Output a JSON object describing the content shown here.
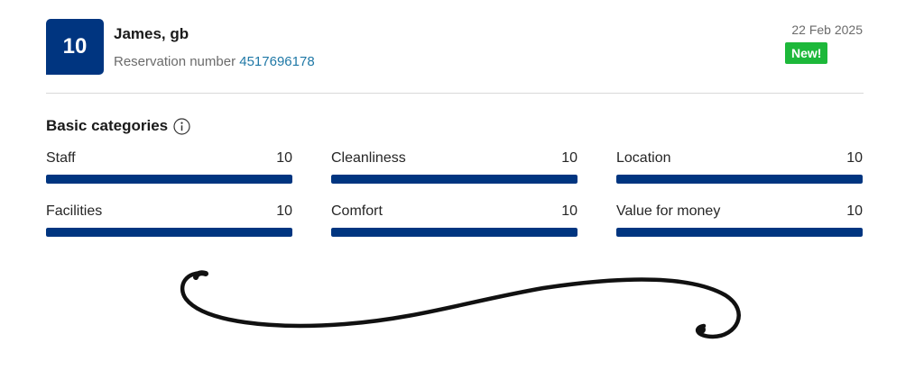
{
  "review": {
    "score": "10",
    "guest_name": "James, gb",
    "reservation_label": "Reservation number",
    "reservation_number": "4517696178",
    "date": "22 Feb 2025",
    "badge": "New!"
  },
  "basic_categories": {
    "heading": "Basic categories",
    "max_score": 10,
    "items": [
      {
        "label": "Staff",
        "score": "10",
        "fraction": 1.0
      },
      {
        "label": "Cleanliness",
        "score": "10",
        "fraction": 1.0
      },
      {
        "label": "Location",
        "score": "10",
        "fraction": 1.0
      },
      {
        "label": "Facilities",
        "score": "10",
        "fraction": 1.0
      },
      {
        "label": "Comfort",
        "score": "10",
        "fraction": 1.0
      },
      {
        "label": "Value for money",
        "score": "10",
        "fraction": 1.0
      }
    ]
  },
  "colors": {
    "brand_blue": "#003580",
    "badge_green": "#1db83a",
    "link_blue": "#1f78a6"
  },
  "icons": {
    "info": "info-icon",
    "decoration": "flourish-decoration"
  }
}
